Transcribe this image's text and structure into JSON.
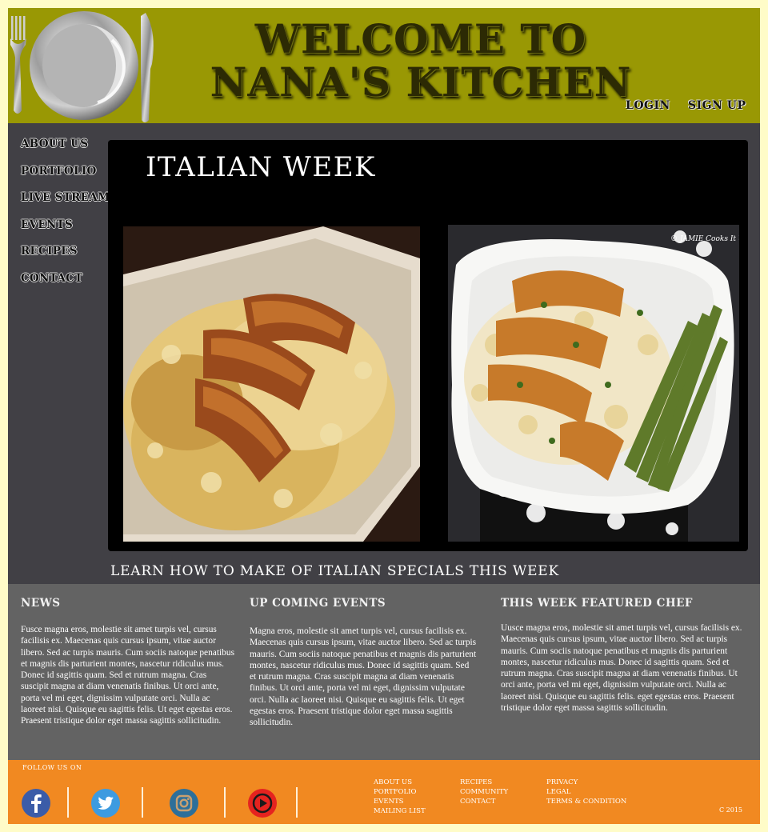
{
  "header": {
    "title": "Welcome to Nana's Kitchen",
    "login_label": "Login",
    "signup_label": "Sign Up",
    "logo_icon": "plate-fork-knife-icon"
  },
  "sidebar": {
    "items": [
      {
        "label": "About Us"
      },
      {
        "label": "Portfolio"
      },
      {
        "label": "Live Stream"
      },
      {
        "label": "Events"
      },
      {
        "label": "Recipes"
      },
      {
        "label": "Contact"
      }
    ]
  },
  "feature": {
    "title": "Italian Week",
    "tagline": "Learn how to make of Italian Specials this week",
    "photo_left_watermark": "",
    "photo_right_watermark": "© JAMIE Cooks It Up!"
  },
  "info": {
    "news": {
      "heading": "News",
      "text": "Fusce magna eros, molestie sit amet turpis vel, cursus facilisis ex. Maecenas quis cursus ipsum, vitae auctor libero. Sed ac turpis mauris. Cum sociis natoque penatibus et magnis dis parturient montes, nascetur ridiculus mus. Donec id sagittis quam. Sed et rutrum magna. Cras suscipit magna at diam venenatis finibus. Ut orci ante, porta vel mi eget, dignissim vulputate orci. Nulla ac laoreet nisi. Quisque eu sagittis felis. Ut eget egestas eros. Praesent tristique dolor eget massa sagittis sollicitudin."
    },
    "events": {
      "heading": "Up Coming Events",
      "text": "Magna eros, molestie sit amet turpis vel, cursus facilisis ex. Maecenas quis cursus ipsum, vitae auctor libero. Sed ac turpis mauris. Cum sociis natoque penatibus et magnis dis parturient montes, nascetur ridiculus mus. Donec id sagittis quam. Sed et rutrum magna. Cras suscipit magna at diam venenatis finibus. Ut orci ante, porta vel mi eget, dignissim vulputate orci. Nulla ac laoreet nisi. Quisque eu sagittis felis. Ut eget egestas eros. Praesent tristique dolor eget massa sagittis sollicitudin."
    },
    "chef": {
      "heading": "This Week Featured Chef",
      "text": "Uusce magna eros, molestie sit amet turpis vel, cursus facilisis ex. Maecenas quis cursus ipsum, vitae auctor libero. Sed ac turpis mauris. Cum sociis natoque penatibus et magnis dis parturient montes, nascetur ridiculus mus. Donec id sagittis quam. Sed et rutrum magna. Cras suscipit magna at diam venenatis finibus. Ut orci ante, porta vel mi eget, dignissim vulputate orci. Nulla ac laoreet nisi. Quisque eu sagittis felis. eget egestas eros. Praesent tristique dolor eget massa sagittis sollicitudin."
    }
  },
  "footer": {
    "follow_label": "Follow us on",
    "social": [
      {
        "icon": "facebook-icon",
        "color": "#3b5ca8"
      },
      {
        "icon": "twitter-icon",
        "color": "#3d9be0"
      },
      {
        "icon": "instagram-icon",
        "color": "#2d6f99"
      },
      {
        "icon": "youtube-icon",
        "color": "#e5231f"
      }
    ],
    "links_col1": [
      "About Us",
      "Portfolio",
      "Events",
      "Mailing List"
    ],
    "links_col2": [
      "Recipes",
      "Community",
      "Contact"
    ],
    "links_col3": [
      "Privacy",
      "Legal",
      "Terms & Condition"
    ],
    "copyright": "C 2015"
  },
  "colors": {
    "page_bg": "#fffcc8",
    "header_bg": "#999804",
    "main_bg": "#414045",
    "info_bg": "#636363",
    "footer_bg": "#f18921"
  }
}
